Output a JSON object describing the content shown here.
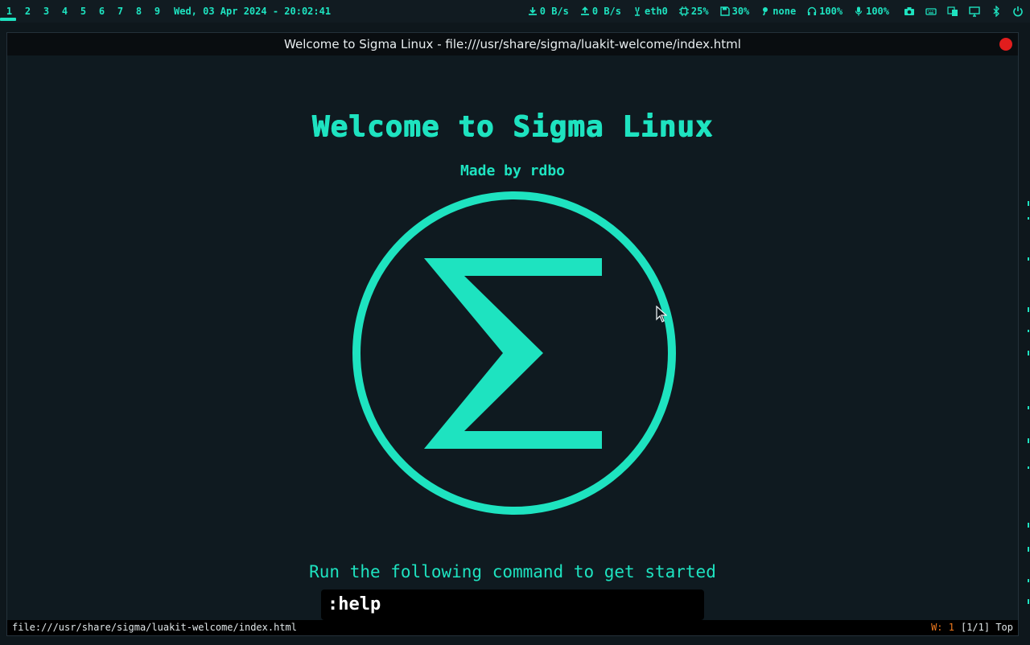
{
  "workspaces": [
    "1",
    "2",
    "3",
    "4",
    "5",
    "6",
    "7",
    "8",
    "9"
  ],
  "active_workspace": "1",
  "datetime": "Wed, 03 Apr 2024 - 20:02:41",
  "status": {
    "download": "0 B/s",
    "upload": "0 B/s",
    "network": "eth0",
    "cpu": "25%",
    "disk": "30%",
    "vpn": "none",
    "headphone_volume": "100%",
    "mic_volume": "100%"
  },
  "tray_icons": [
    "camera-icon",
    "keyboard-icon",
    "translate-icon",
    "display-icon",
    "bluetooth-icon",
    "power-icon"
  ],
  "window": {
    "title": "Welcome to Sigma Linux - file:///usr/share/sigma/luakit-welcome/index.html"
  },
  "page": {
    "heading": "Welcome to Sigma Linux",
    "subheading": "Made by rdbo",
    "prompt": "Run the following command to get started",
    "command": ":help"
  },
  "statusbar": {
    "url": "file:///usr/share/sigma/luakit-welcome/index.html",
    "window_count": "W: 1",
    "position": "[1/1] Top"
  },
  "colors": {
    "accent": "#1ee3c0",
    "background": "#0e171c",
    "close": "#e11d1d",
    "window_count": "#f07a1e"
  }
}
